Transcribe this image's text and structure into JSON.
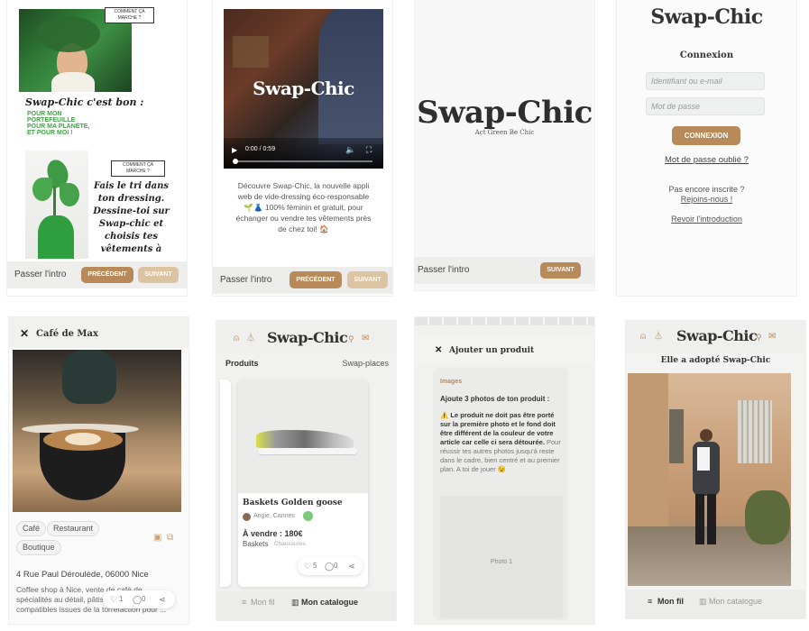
{
  "colors": {
    "accent": "#b88959",
    "accent_light": "#dcc3a1",
    "green": "#4caf50"
  },
  "s1": {
    "badge1": "COMMENT ÇA MARCHE ?",
    "tagline": "Swap-Chic c'est bon :",
    "green_lines": [
      "POUR MON",
      "PORTEFEUILLE",
      "POUR MA PLANÈTE,",
      "ET POUR MOI !"
    ],
    "badge2": "COMMENT ÇA MARCHE ?",
    "hand_lines": [
      "Fais le tri dans",
      "ton dressing.",
      "Dessine-toi sur",
      "Swap-chic et",
      "choisis tes",
      "vêtements à"
    ],
    "skip": "Passer l'intro",
    "prev": "PRÉCÉDENT",
    "next": "SUIVANT"
  },
  "s2": {
    "video_brand": "Swap-Chic",
    "time": "0:00 / 0:59",
    "desc": "Découvre Swap-Chic, la nouvelle appli web de vide-dressing éco-responsable 🌱👗 100% féminin et gratuit, pour échanger ou vendre tes vêtements près de chez toi! 🏠",
    "skip": "Passer l'intro",
    "prev": "PRÉCÉDENT",
    "next": "SUIVANT"
  },
  "s3": {
    "logo": "Swap-Chic",
    "tagline": "Act Green Be Chic",
    "skip": "Passer l'intro",
    "next": "SUIVANT"
  },
  "s4": {
    "logo": "Swap-Chic",
    "title": "Connexion",
    "login_placeholder": "Identifiant ou e-mail",
    "password_placeholder": "Mot de passe",
    "submit": "CONNEXION",
    "forgot": "Mot de passe oublié ?",
    "not_registered": "Pas encore inscrite ?",
    "join": "Rejoins-nous !",
    "back": "Revoir l'introduction"
  },
  "s5": {
    "title": "Café de Max",
    "tags": [
      "Café",
      "Restaurant",
      "Boutique"
    ],
    "address": "4 Rue Paul Déroulède, 06000 Nice",
    "desc": "Coffee shop à Nice, vente de café de spécialités au détail, pâtisseries, capsules compatibles issues de la torréfaction pour ... ",
    "likes": "1",
    "comments": "0"
  },
  "s6": {
    "logo": "Swap-Chic",
    "tab1": "Produits",
    "tab2": "Swap-places",
    "product_name": "Baskets Golden goose",
    "seller": "Angie, Cannes",
    "price": "À vendre : 180€",
    "category": "Baskets",
    "brand_tag": "Chaussures",
    "likes": "5",
    "comments": "0",
    "nav1": "Mon fil",
    "nav2": "Mon catalogue"
  },
  "s7": {
    "title": "Ajouter un produit",
    "section": "Images",
    "heading": "Ajoute 3 photos de ton produit :",
    "warning_bold": "⚠️ Le produit ne doit pas être porté sur la première photo et le fond doit être différent de la couleur de votre article car celle ci sera détourée.",
    "warning_rest": " Pour réussir tes autres photos jusqu'à reste dans le cadre, bien centré et au premier plan. A toi de jouer 😉",
    "photo_label": "Photo 1"
  },
  "s8": {
    "logo": "Swap-Chic",
    "title": "Elle a adopté Swap-Chic",
    "nav1": "Mon fil",
    "nav2": "Mon catalogue"
  }
}
